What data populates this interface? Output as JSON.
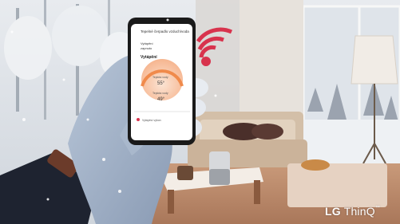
{
  "image": {
    "brand": {
      "lg": "LG",
      "thinq": "ThinQ",
      "tm": "™"
    },
    "phone_app": {
      "title": "Tepelné čerpadlo vzduch/voda",
      "tabs": [
        "Vytápění",
        "zapnuto"
      ],
      "panel_title": "Vytápění",
      "temp_label_1": "Teplota vody",
      "temp_value_1": "55°",
      "temp_label_2": "Teplota vody",
      "temp_value_2": "49°",
      "bottom_label": "Vytápěcí výkon"
    },
    "colors": {
      "wifi": "#d8334d",
      "gauge": "#f08a4b",
      "snow_sky": "#d9dde3",
      "sofa": "#d8c6b1",
      "floor": "#bf8d6e"
    }
  }
}
